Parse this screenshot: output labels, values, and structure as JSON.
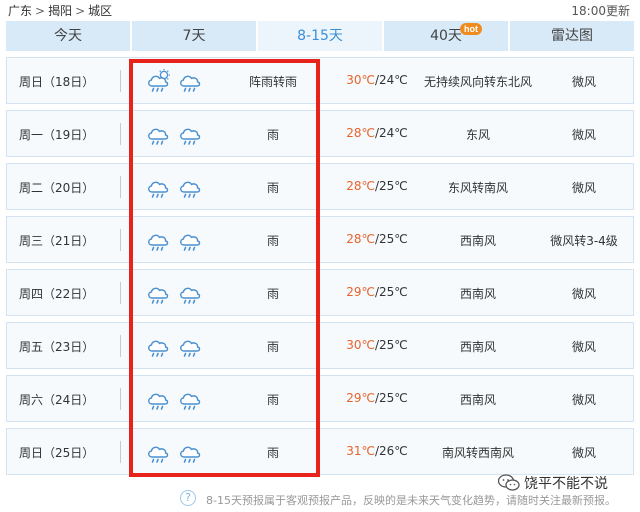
{
  "breadcrumb": {
    "province": "广东",
    "city": "揭阳",
    "district": "城区",
    "separator": ">"
  },
  "updated": "18:00更新",
  "tabs": [
    {
      "label": "今天",
      "active": false
    },
    {
      "label": "7天",
      "active": false
    },
    {
      "label": "8-15天",
      "active": true
    },
    {
      "label": "40天",
      "active": false,
      "badge": "hot"
    },
    {
      "label": "雷达图",
      "active": false
    }
  ],
  "forecast": [
    {
      "date": "周日（18日）",
      "day_icon": "cloud-sun-rain-icon",
      "night_icon": "cloud-rain-icon",
      "condition": "阵雨转雨",
      "high": "30℃",
      "low": "24℃",
      "wind": "无持续风向转东北风",
      "wind_level": "微风"
    },
    {
      "date": "周一（19日）",
      "day_icon": "cloud-rain-icon",
      "night_icon": "cloud-rain-icon",
      "condition": "雨",
      "high": "28℃",
      "low": "24℃",
      "wind": "东风",
      "wind_level": "微风"
    },
    {
      "date": "周二（20日）",
      "day_icon": "cloud-rain-icon",
      "night_icon": "cloud-rain-icon",
      "condition": "雨",
      "high": "28℃",
      "low": "25℃",
      "wind": "东风转南风",
      "wind_level": "微风"
    },
    {
      "date": "周三（21日）",
      "day_icon": "cloud-rain-icon",
      "night_icon": "cloud-rain-icon",
      "condition": "雨",
      "high": "28℃",
      "low": "25℃",
      "wind": "西南风",
      "wind_level": "微风转3-4级"
    },
    {
      "date": "周四（22日）",
      "day_icon": "cloud-rain-icon",
      "night_icon": "cloud-rain-icon",
      "condition": "雨",
      "high": "29℃",
      "low": "25℃",
      "wind": "西南风",
      "wind_level": "微风"
    },
    {
      "date": "周五（23日）",
      "day_icon": "cloud-rain-icon",
      "night_icon": "cloud-rain-icon",
      "condition": "雨",
      "high": "30℃",
      "low": "25℃",
      "wind": "西南风",
      "wind_level": "微风"
    },
    {
      "date": "周六（24日）",
      "day_icon": "cloud-rain-icon",
      "night_icon": "cloud-rain-icon",
      "condition": "雨",
      "high": "29℃",
      "low": "25℃",
      "wind": "西南风",
      "wind_level": "微风"
    },
    {
      "date": "周日（25日）",
      "day_icon": "cloud-rain-icon",
      "night_icon": "cloud-rain-icon",
      "condition": "雨",
      "high": "31℃",
      "low": "26℃",
      "wind": "南风转西南风",
      "wind_level": "微风"
    }
  ],
  "footer": {
    "help_glyph": "?",
    "note": "8-15天预报属于客观预报产品，反映的是未来天气变化趋势，请随时关注最新预报。"
  },
  "watermark": {
    "icon": "wechat-icon",
    "text": "饶平不能不说"
  },
  "colors": {
    "high_temp": "#e8632a",
    "tab_bg": "#d8eaf8",
    "tab_active_text": "#3a8fd6",
    "highlight_border": "#e8231c",
    "hot_badge": "#f08c1f",
    "icon_stroke": "#4a8fd0"
  }
}
